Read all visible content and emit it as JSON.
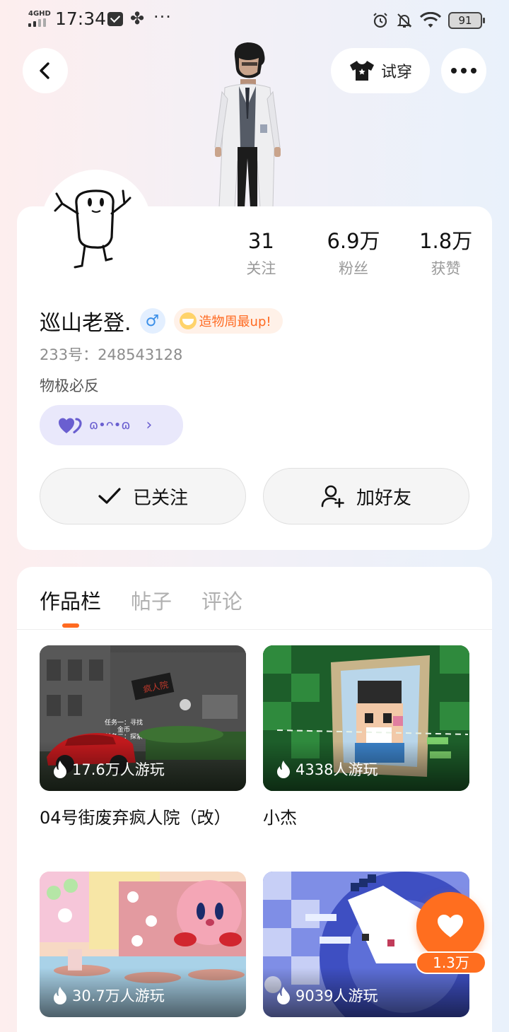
{
  "status_bar": {
    "network": "4GHD",
    "time": "17:34",
    "more_indicator": "···",
    "battery": "91"
  },
  "nav": {
    "tryon_label": "试穿"
  },
  "profile": {
    "stats": [
      {
        "value": "31",
        "label": "关注"
      },
      {
        "value": "6.9万",
        "label": "粉丝"
      },
      {
        "value": "1.8万",
        "label": "获赞"
      }
    ],
    "username": "巡山老登.",
    "gender_symbol": "♂",
    "award_badge": "造物周最up!",
    "uid": "233号：248543128",
    "bio": "物极必反",
    "emote": "ɷ•ᴖ•ɷ",
    "follow_button": "已关注",
    "add_friend_button": "加好友"
  },
  "tabs": [
    {
      "label": "作品栏",
      "active": true
    },
    {
      "label": "帖子",
      "active": false
    },
    {
      "label": "评论",
      "active": false
    }
  ],
  "works": [
    {
      "title": "04号街废弃疯人院（改）",
      "plays": "17.6万人游玩"
    },
    {
      "title": "小杰",
      "plays": "4338人游玩"
    },
    {
      "title": "",
      "plays": "30.7万人游玩"
    },
    {
      "title": "",
      "plays": "9039人游玩"
    }
  ],
  "thumb_text": {
    "sign": "疯人院",
    "task_line1": "任务一：寻找",
    "task_line2": "金币",
    "task_line3": "任务二：探索"
  },
  "floating_like": {
    "count": "1.3万"
  },
  "colors": {
    "accent_orange": "#ff6a21",
    "gender_blue": "#3b8fe8",
    "emote_purple": "#6a5fd0"
  },
  "icons": {
    "back": "chevron-left-icon",
    "tryon": "tshirt-icon",
    "more": "more-dots-icon",
    "follow": "check-icon",
    "add_friend": "add-user-icon",
    "plays": "flame-icon",
    "like": "heart-icon"
  }
}
